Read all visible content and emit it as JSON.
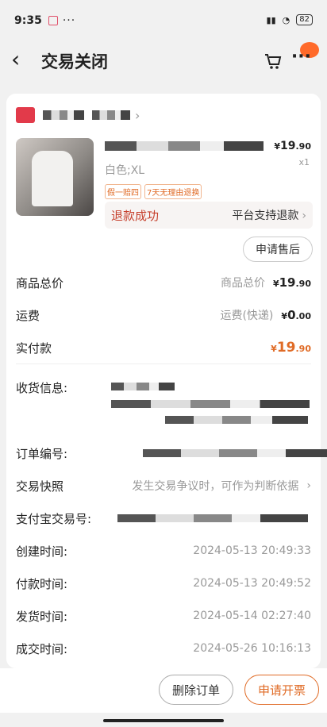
{
  "status_bar": {
    "time": "9:35",
    "dots": "···",
    "battery": "82"
  },
  "nav": {
    "back": "‹",
    "title": "交易关闭"
  },
  "product": {
    "price_symbol": "¥",
    "price_int": "19",
    "price_dec": ".90",
    "qty": "x1",
    "spec": "白色;XL",
    "tags": [
      "假一赔四",
      "7天无理由退换"
    ]
  },
  "refund": {
    "status": "退款成功",
    "support": "平台支持退款"
  },
  "after_sale_button": "申请售后",
  "totals": {
    "goods_label": "商品总价",
    "goods_sub": "商品总价",
    "goods_int": "19",
    "goods_dec": ".90",
    "shipping_label": "运费",
    "shipping_sub": "运费(快递)",
    "shipping_int": "0",
    "shipping_dec": ".00",
    "paid_label": "实付款",
    "paid_int": "19",
    "paid_dec": ".90",
    "symbol": "¥"
  },
  "info": {
    "address_label": "收货信息:",
    "order_no_label": "订单编号:",
    "snapshot_label": "交易快照",
    "snapshot_value": "发生交易争议时，可作为判断依据",
    "alipay_label": "支付宝交易号:",
    "created_label": "创建时间:",
    "created_value": "2024-05-13 20:49:33",
    "paid_label": "付款时间:",
    "paid_value": "2024-05-13 20:49:52",
    "shipped_label": "发货时间:",
    "shipped_value": "2024-05-14 02:27:40",
    "done_label": "成交时间:",
    "done_value": "2024-05-26 10:16:13"
  },
  "bottom": {
    "delete": "删除订单",
    "invoice": "申请开票"
  },
  "colors": {
    "accent": "#e06b26",
    "refund_red": "#c6402d",
    "background": "#f1f1f1"
  }
}
